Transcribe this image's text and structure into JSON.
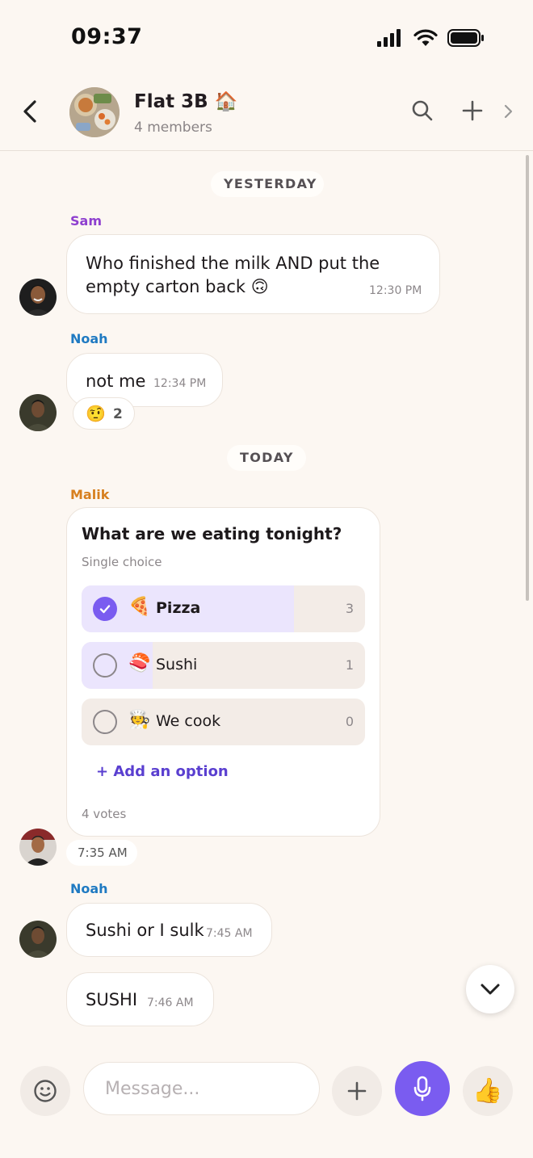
{
  "status_bar": {
    "time": "09:37"
  },
  "header": {
    "title": "Flat 3B 🏠",
    "subtitle": "4 members"
  },
  "messages": {
    "day1": "YESTERDAY",
    "day2": "TODAY",
    "m1": {
      "sender": "Sam",
      "text_line1": "Who finished the milk AND put the",
      "text_line2": "empty carton back 🙃",
      "time": "12:30 PM"
    },
    "m2": {
      "sender": "Noah",
      "text": "not me",
      "time": "12:34 PM",
      "reaction_emoji": "🤨",
      "reaction_count": "2"
    },
    "poll": {
      "sender": "Malik",
      "question": "What are we eating tonight?",
      "type": "Single choice",
      "options": [
        {
          "emoji": "🍕",
          "label": "Pizza",
          "count": "3",
          "fraction": 0.75,
          "selected": true
        },
        {
          "emoji": "🍣",
          "label": "Sushi",
          "count": "1",
          "fraction": 0.25,
          "selected": false
        },
        {
          "emoji": "🧑‍🍳",
          "label": "We cook",
          "count": "0",
          "fraction": 0,
          "selected": false
        }
      ],
      "add_option": "+ Add an option",
      "votes": "4 votes",
      "time": "7:35 AM"
    },
    "m3": {
      "sender": "Noah",
      "text": "Sushi or I sulk",
      "time": "7:45 AM"
    },
    "m4": {
      "text": "SUSHI",
      "time": "7:46 AM"
    }
  },
  "composer": {
    "placeholder": "Message...",
    "like_emoji": "👍"
  },
  "colors": {
    "accent": "#7a5cf0",
    "sam": "#8e3fcf",
    "noah": "#1f7ac2",
    "malik": "#d77f1f",
    "background": "#fcf7f2"
  }
}
